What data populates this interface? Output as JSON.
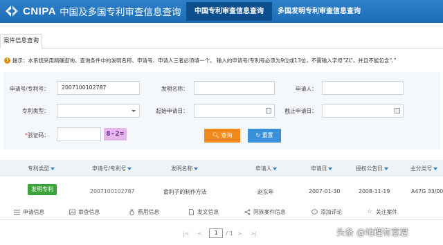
{
  "header": {
    "brand": "CNIPA",
    "brand_sub": "中国及多国专利审查信息查询",
    "nav": [
      "中国专利审查信息查询",
      "多国发明专利审查信息查询"
    ]
  },
  "tabs": [
    "案件信息查询"
  ],
  "tip": {
    "prefix": "提示：",
    "text": "本系统采用精确查询，查询条件中的发明名称、申请号、申请人三者必须填一个。 输入的申请号/专利号必须为9位或13位，不需输入字母“ZL”，并且不能包含“.”"
  },
  "form": {
    "app_no_label": "申请号/专利号：",
    "app_no_value": "2007100102787",
    "invention_name_label": "发明名称：",
    "invention_name_value": "",
    "applicant_label": "申请人：",
    "applicant_value": "",
    "patent_type_label": "专利类型：",
    "patent_type_value": "",
    "start_date_label": "起始申请日：",
    "start_date_value": "",
    "end_date_label": "截止申请日：",
    "end_date_value": "",
    "captcha_required": "*",
    "captcha_label": "验证码：",
    "captcha_value": "",
    "captcha_image_text": "8-2=",
    "query_button": "查询",
    "reset_button": "重置"
  },
  "table": {
    "columns": [
      "专利类型",
      "申请号/专利号",
      "发明名称",
      "申请人",
      "申请日",
      "授权公告日",
      "主分类号"
    ],
    "rows": [
      {
        "type": "发明专利",
        "app_no": "2007100102787",
        "name": "畲利子的制作方法",
        "applicant": "赵东年",
        "app_date": "2007-01-30",
        "grant_date": "2008-11-19",
        "main_class": "A47G 33/00"
      }
    ],
    "row_actions": [
      "申请信息",
      "审查信息",
      "费用信息",
      "发文信息",
      "同族案件信息",
      "添加评论",
      "关注案件"
    ]
  },
  "pager": {
    "first": "|<",
    "prev": "<",
    "current_page": "1",
    "separator": "/",
    "total_pages": "1",
    "next": ">",
    "last": ">|"
  },
  "watermark": "头条 @地理有意思",
  "colors": {
    "header_bg": "#1d6db8",
    "nav_active_bg": "#0c4f8c",
    "query_button": "#f08a1c",
    "reset_button": "#3a8fd9",
    "invention_badge": "#3aa43a",
    "tip_accent": "#e98a00"
  }
}
